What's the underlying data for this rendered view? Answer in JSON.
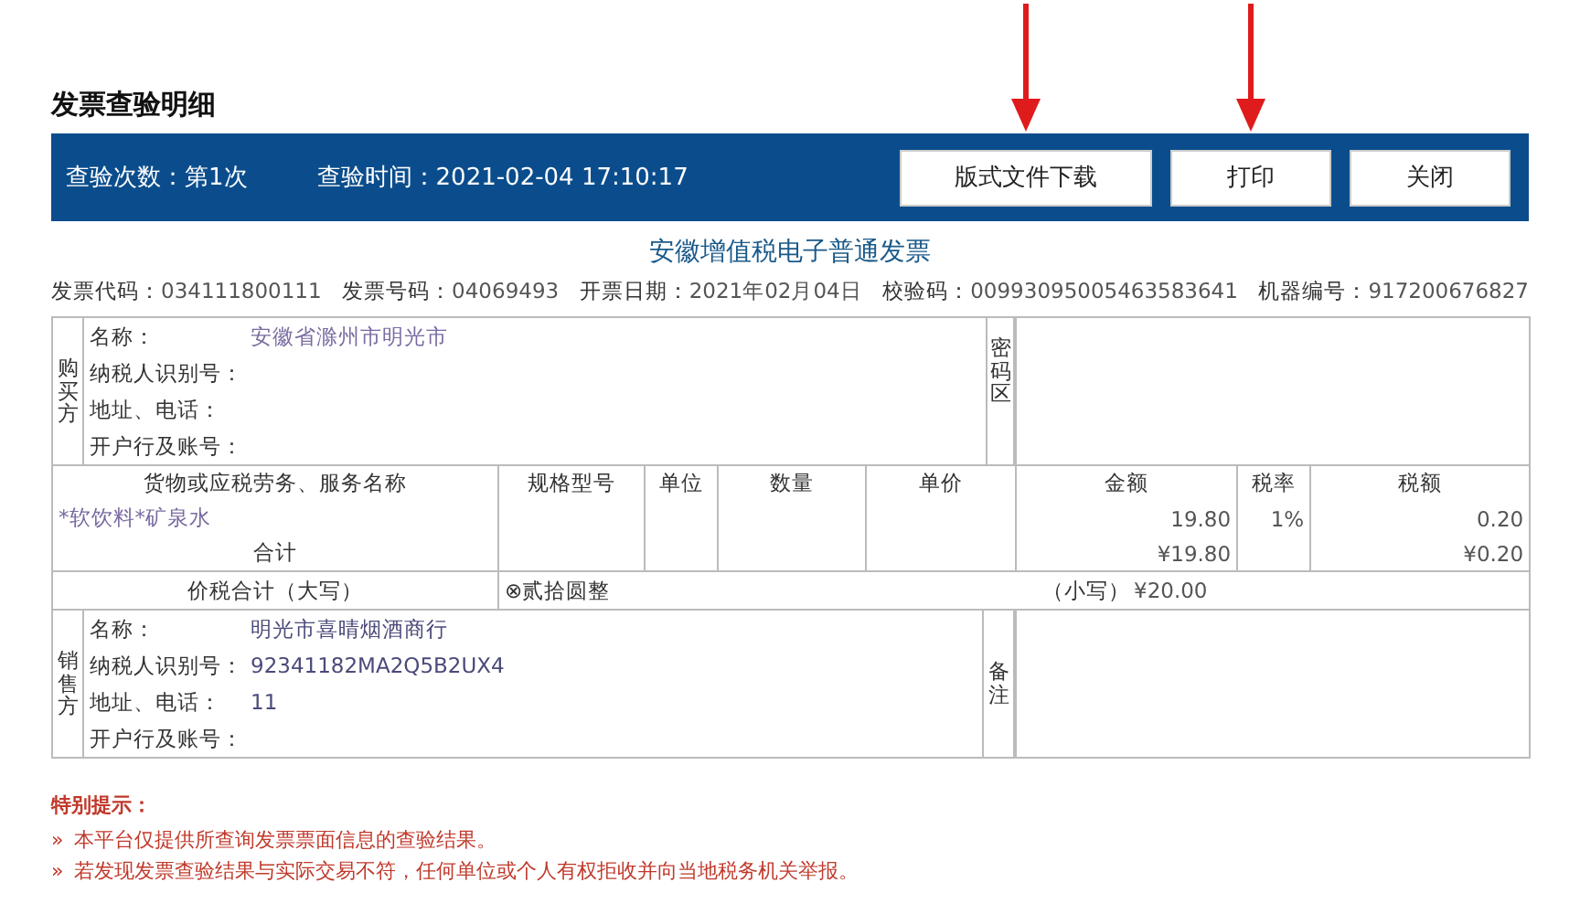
{
  "page_title": "发票查验明细",
  "toolbar": {
    "check_count": "查验次数：第1次",
    "check_time": "查验时间：2021-02-04 17:10:17",
    "buttons": [
      {
        "label": "版式文件下载",
        "marked": true
      },
      {
        "label": "打印",
        "marked": true
      },
      {
        "label": "关闭",
        "marked": false
      }
    ]
  },
  "invoice": {
    "title": "安徽增值税电子普通发票",
    "meta": [
      {
        "label": "发票代码：",
        "value": "034111800111"
      },
      {
        "label": "发票号码：",
        "value": "04069493"
      },
      {
        "label": "开票日期：",
        "value": "2021年02月04日"
      },
      {
        "label": "校验码：",
        "value": "00993095005463583641"
      },
      {
        "label": "机器编号：",
        "value": "917200676827"
      }
    ],
    "buyer": {
      "side_label": "购买方",
      "fields": [
        {
          "label": "名称：",
          "value": "安徽省滁州市明光市"
        },
        {
          "label": "纳税人识别号："
        },
        {
          "label": "地址、电话："
        },
        {
          "label": "开户行及账号："
        }
      ]
    },
    "cipher_label": "密码区",
    "goods": {
      "columns": [
        "货物或应税劳务、服务名称",
        "规格型号",
        "单位",
        "数量",
        "单价",
        "金额",
        "税率",
        "税额"
      ],
      "rows": [
        [
          "*软饮料*矿泉水",
          "",
          "",
          "",
          "",
          "19.80",
          "1%",
          "0.20"
        ]
      ],
      "total": {
        "label": "合计",
        "amount": "¥19.80",
        "tax": "¥0.20"
      }
    },
    "grand_total": {
      "label": "价税合计（大写）",
      "words": "⊗贰拾圆整",
      "small_label": "（小写）",
      "small_value": "¥20.00"
    },
    "seller": {
      "side_label": "销售方",
      "fields": [
        {
          "label": "名称：",
          "value": "明光市喜晴烟酒商行"
        },
        {
          "label": "纳税人识别号：",
          "value": "92341182MA2Q5B2UX4"
        },
        {
          "label": "地址、电话：",
          "value": "11"
        },
        {
          "label": "开户行及账号："
        }
      ]
    },
    "remarks_label": "备注"
  },
  "notice": {
    "title": "特别提示：",
    "bullet": "»",
    "items": [
      "本平台仅提供所查询发票票面信息的查验结果。",
      "若发现发票查验结果与实际交易不符，任何单位或个人有权拒收并向当地税务机关举报。"
    ]
  }
}
